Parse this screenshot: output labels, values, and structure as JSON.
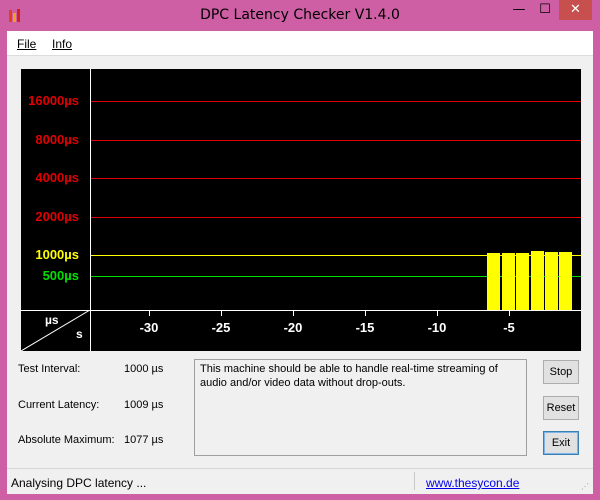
{
  "window": {
    "title": "DPC Latency Checker V1.4.0",
    "controls": {
      "minimize": "—",
      "maximize": "☐",
      "close": "✕"
    }
  },
  "menu": {
    "file": "File",
    "info": "Info"
  },
  "chart_data": {
    "type": "bar",
    "y_scale": "log2",
    "y_gridlines": [
      {
        "label": "16000µs",
        "value": 16000,
        "color": "#e00000"
      },
      {
        "label": "8000µs",
        "value": 8000,
        "color": "#e00000"
      },
      {
        "label": "4000µs",
        "value": 4000,
        "color": "#e00000"
      },
      {
        "label": "2000µs",
        "value": 2000,
        "color": "#e00000"
      },
      {
        "label": "1000µs",
        "value": 1000,
        "color": "#ffff00"
      },
      {
        "label": "500µs",
        "value": 500,
        "color": "#00e000"
      }
    ],
    "y_unit": "µs",
    "x_unit": "s",
    "xlim": [
      -34,
      0
    ],
    "x_ticks": [
      -30,
      -25,
      -20,
      -15,
      -10,
      -5
    ],
    "x_tick_labels": [
      "-30",
      "-25",
      "-20",
      "-15",
      "-10",
      "-5"
    ],
    "bar_color": "#ffff00",
    "x": [
      -6,
      -5,
      -4,
      -3,
      -2,
      -1
    ],
    "values": [
      1040,
      1040,
      1040,
      1077,
      1060,
      1050
    ]
  },
  "stats": {
    "test_interval_label": "Test Interval:",
    "test_interval_value": "1000 µs",
    "current_latency_label": "Current Latency:",
    "current_latency_value": "1009 µs",
    "absolute_maximum_label": "Absolute Maximum:",
    "absolute_maximum_value": "1077 µs"
  },
  "message": "This machine should be able to handle real-time streaming of audio and/or video data without drop-outs.",
  "buttons": {
    "stop": "Stop",
    "reset": "Reset",
    "exit": "Exit"
  },
  "status": {
    "text": "Analysing DPC latency ...",
    "link": "www.thesycon.de",
    "grip": "⋰"
  },
  "icon": {
    "name": "bar-chart-icon",
    "colors": [
      "#e04020",
      "#f0a020",
      "#d02020"
    ]
  }
}
